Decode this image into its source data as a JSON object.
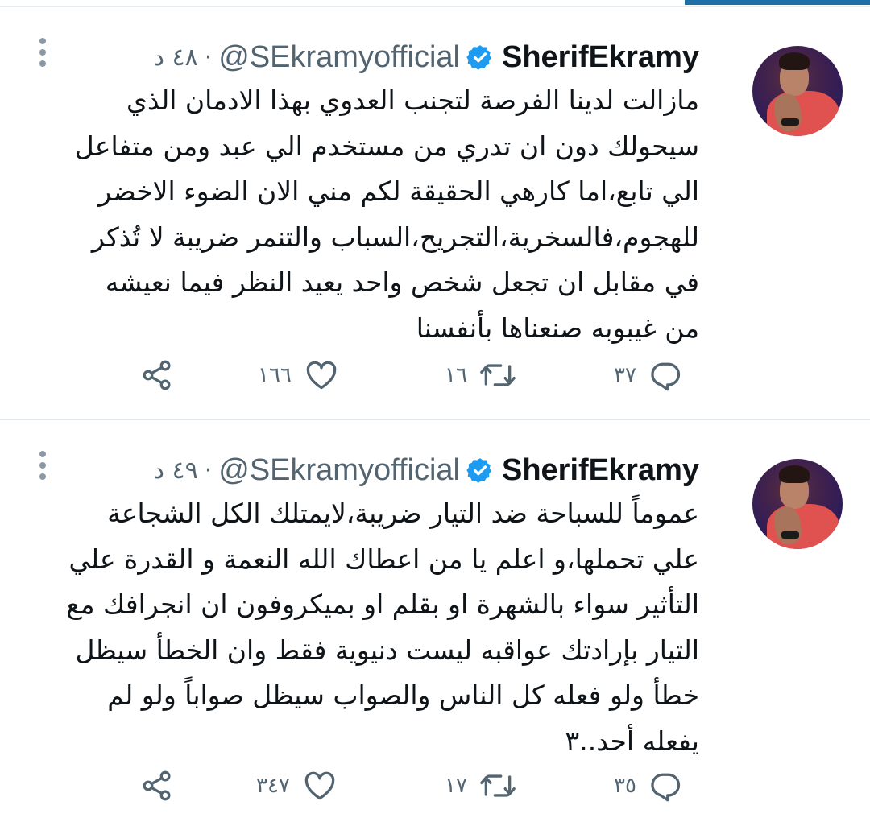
{
  "tweets": [
    {
      "display_name": "SherifEkramy",
      "handle": "@SEkramyofficial",
      "separator": "·",
      "time": "٤٨ د",
      "lines": [
        "مازالت لدينا الفرصة لتجنب العدوي بهذا الادمان الذي",
        "سيحولك دون ان تدري من مستخدم الي عبد ومن متفاعل",
        "الي تابع،اما كارهي الحقيقة لكم مني الان الضوء الاخضر",
        "للهجوم،فالسخرية،التجريح،السباب والتنمر ضريبة لا تُذكر",
        "في مقابل ان تجعل شخص واحد يعيد النظر فيما نعيشه",
        "من غيبوبه صنعناها بأنفسنا"
      ],
      "replies": "٣٧",
      "retweets": "١٦",
      "likes": "١٦٦"
    },
    {
      "display_name": "SherifEkramy",
      "handle": "@SEkramyofficial",
      "separator": "·",
      "time": "٤٩ د",
      "lines": [
        "عموماً للسباحة ضد التيار ضريبة،لايمتلك الكل الشجاعة",
        "علي تحملها،و اعلم يا من اعطاك الله النعمة و القدرة علي",
        "التأثير سواء بالشهرة او بقلم او بميكروفون ان انجرافك مع",
        "التيار بإرادتك عواقبه ليست دنيوية فقط وان الخطأ سيظل",
        "خطأ ولو فعله كل الناس والصواب سيظل صواباً ولو لم",
        "يفعله أحد..٣"
      ],
      "replies": "٣٥",
      "retweets": "١٧",
      "likes": "٣٤٧"
    }
  ],
  "icons": {
    "verified": "verified-badge-icon",
    "more": "more-vertical-icon",
    "reply": "reply-icon",
    "retweet": "retweet-icon",
    "like": "heart-icon",
    "share": "share-icon"
  },
  "colors": {
    "text": "#0f1419",
    "secondary": "#536471",
    "verified": "#1d9bf0",
    "divider": "#e1e6ea"
  }
}
